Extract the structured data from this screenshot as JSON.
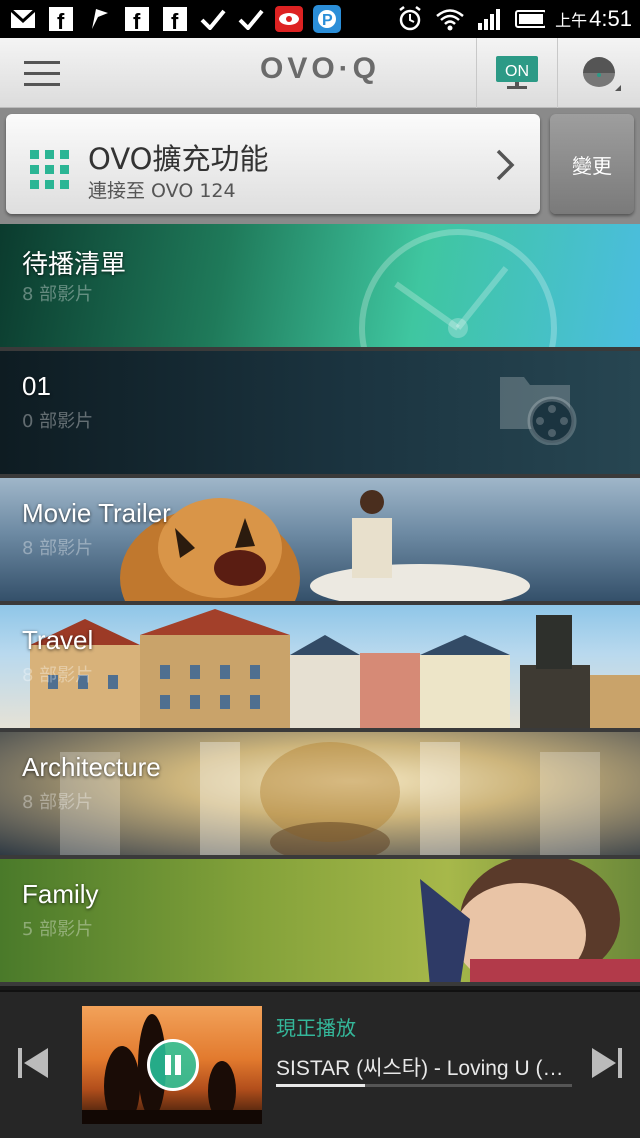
{
  "status_bar": {
    "time_prefix": "上午",
    "time": "4:51"
  },
  "app_bar": {
    "logo": "OVO·Q",
    "tv_badge": "ON"
  },
  "extension": {
    "title": "OVO擴充功能",
    "subtitle": "連接至 OVO 124",
    "change_label": "變更"
  },
  "playlists": [
    {
      "title": "待播清單",
      "count": "8 部影片",
      "theme": "watchlater"
    },
    {
      "title": "01",
      "count": "0 部影片",
      "theme": "folder"
    },
    {
      "title": "Movie Trailer",
      "count": "8 部影片",
      "theme": "trailer"
    },
    {
      "title": "Travel",
      "count": "8 部影片",
      "theme": "travel"
    },
    {
      "title": "Architecture",
      "count": "8 部影片",
      "theme": "architecture"
    },
    {
      "title": "Family",
      "count": "5 部影片",
      "theme": "family"
    }
  ],
  "player": {
    "now_playing_label": "現正播放",
    "song": "SISTAR (씨스타) - Loving U (러빙유) MV",
    "progress_fraction": 0.3
  },
  "colors": {
    "accent": "#34b79a"
  }
}
